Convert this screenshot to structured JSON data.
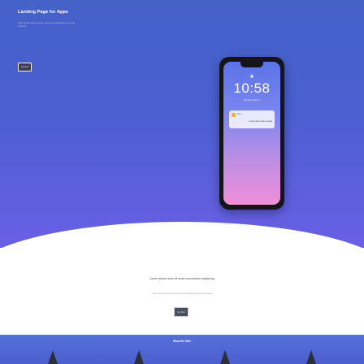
{
  "hero": {
    "title": "Landing Page for Apps",
    "subtitle": "Lorem ipsum dolor sit amet consectetur adipiscing elit sed do eiusmod",
    "button_label": "Get Now"
  },
  "phone": {
    "time": "10:58",
    "date": "Monday, March 5",
    "notification": {
      "app": "Mail",
      "text": "Lorem ipsum dolor sit amet"
    }
  },
  "section2": {
    "title": "Lorem ipsum dolor sit amet consectetur adipiscing",
    "subtitle": "Lorem ipsum dolor sit amet consectetur adipiscing elit sed do eiusmod",
    "button_label": "Get Now"
  },
  "footer": {
    "title": "What We Offer",
    "icons": [
      "feature-icon",
      "feature-icon",
      "feature-icon",
      "feature-icon"
    ]
  },
  "colors": {
    "hero_top": "#4562c9",
    "hero_bottom": "#6a5fe6",
    "footer": "#5470d8",
    "phone_frame": "#141419"
  }
}
